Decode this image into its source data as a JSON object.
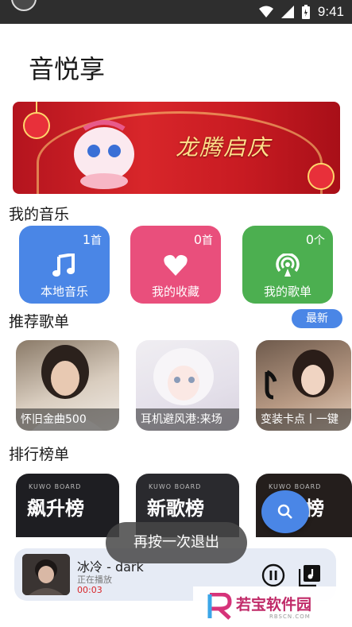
{
  "status_bar": {
    "time": "9:41"
  },
  "app": {
    "title": "音悦享"
  },
  "banner": {
    "text": "龙腾启庆"
  },
  "my_music": {
    "title": "我的音乐",
    "cards": [
      {
        "label": "本地音乐",
        "count": "1",
        "unit": "首",
        "color": "#4a86e6",
        "icon": "music-note-icon"
      },
      {
        "label": "我的收藏",
        "count": "0",
        "unit": "首",
        "color": "#e94f7c",
        "icon": "heart-icon"
      },
      {
        "label": "我的歌单",
        "count": "0",
        "unit": "个",
        "color": "#4caf50",
        "icon": "playlist-podcast-icon"
      }
    ]
  },
  "recommended": {
    "title": "推荐歌单",
    "latest_label": "最新",
    "playlists": [
      {
        "caption": "怀旧金曲500"
      },
      {
        "caption": "耳机避风港:来场"
      },
      {
        "caption": "变装卡点丨一键"
      }
    ]
  },
  "charts": {
    "title": "排行榜单",
    "boards": [
      {
        "brand": "KUWO BOARD",
        "name": "飙升榜"
      },
      {
        "brand": "KUWO BOARD",
        "name": "新歌榜"
      },
      {
        "brand": "KUWO BOARD",
        "name": "榜"
      }
    ]
  },
  "toast": {
    "text": "再按一次退出"
  },
  "player": {
    "song": "冰冷 - dark",
    "state": "正在播放",
    "time": "00:03"
  },
  "watermark": {
    "text": "若宝软件园",
    "url": "RBSCN.COM"
  }
}
